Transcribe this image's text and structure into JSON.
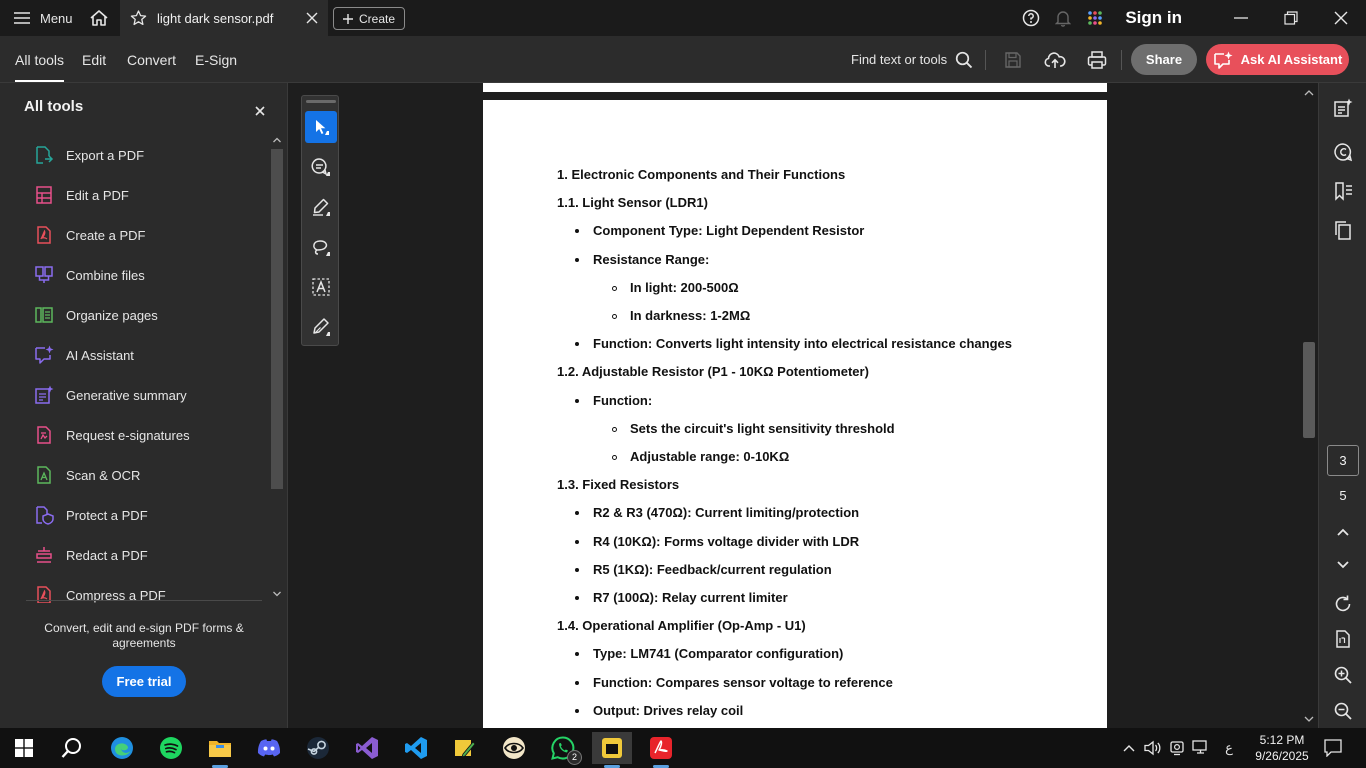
{
  "titlebar": {
    "menu_label": "Menu",
    "tab_title": "light dark sensor.pdf",
    "create_label": "Create",
    "sign_in": "Sign in"
  },
  "toolbar": {
    "tabs": [
      "All tools",
      "Edit",
      "Convert",
      "E-Sign"
    ],
    "find_label": "Find text or tools",
    "share_label": "Share",
    "ai_label": "Ask AI Assistant"
  },
  "left_panel": {
    "title": "All tools",
    "items": [
      {
        "label": "Export a PDF",
        "icon": "export-pdf-icon",
        "color": "#26a69a"
      },
      {
        "label": "Edit a PDF",
        "icon": "edit-pdf-icon",
        "color": "#e8508a"
      },
      {
        "label": "Create a PDF",
        "icon": "create-pdf-icon",
        "color": "#e8505b"
      },
      {
        "label": "Combine files",
        "icon": "combine-files-icon",
        "color": "#8a6cf0"
      },
      {
        "label": "Organize pages",
        "icon": "organize-pages-icon",
        "color": "#5cb85c"
      },
      {
        "label": "AI Assistant",
        "icon": "ai-assistant-icon",
        "color": "#8a6cf0"
      },
      {
        "label": "Generative summary",
        "icon": "generative-summary-icon",
        "color": "#8a6cf0"
      },
      {
        "label": "Request e-signatures",
        "icon": "request-esignatures-icon",
        "color": "#e8508a"
      },
      {
        "label": "Scan & OCR",
        "icon": "scan-ocr-icon",
        "color": "#5cb85c"
      },
      {
        "label": "Protect a PDF",
        "icon": "protect-pdf-icon",
        "color": "#8a6cf0"
      },
      {
        "label": "Redact a PDF",
        "icon": "redact-pdf-icon",
        "color": "#e8508a"
      },
      {
        "label": "Compress a PDF",
        "icon": "compress-pdf-icon",
        "color": "#e8505b"
      }
    ],
    "promo_text": "Convert, edit and e-sign PDF forms & agreements",
    "free_trial_label": "Free trial"
  },
  "document": {
    "lines": [
      {
        "text": "1. Electronic Components and Their Functions",
        "level": 0
      },
      {
        "text": "1.1. Light Sensor (LDR1)",
        "level": 0
      },
      {
        "text": "Component Type: Light Dependent Resistor",
        "level": 1
      },
      {
        "text": "Resistance Range:",
        "level": 1
      },
      {
        "text": "In light: 200-500Ω",
        "level": 2
      },
      {
        "text": "In darkness: 1-2MΩ",
        "level": 2
      },
      {
        "text": "Function: Converts light intensity into electrical resistance changes",
        "level": 1
      },
      {
        "text": "1.2. Adjustable Resistor (P1 - 10KΩ Potentiometer)",
        "level": 0
      },
      {
        "text": "Function:",
        "level": 1
      },
      {
        "text": "Sets the circuit's light sensitivity threshold",
        "level": 2
      },
      {
        "text": "Adjustable range: 0-10KΩ",
        "level": 2
      },
      {
        "text": "1.3. Fixed Resistors",
        "level": 0
      },
      {
        "text": "R2 & R3 (470Ω): Current limiting/protection",
        "level": 1
      },
      {
        "text": "R4 (10KΩ): Forms voltage divider with LDR",
        "level": 1
      },
      {
        "text": "R5 (1KΩ): Feedback/current regulation",
        "level": 1
      },
      {
        "text": "R7 (100Ω): Relay current limiter",
        "level": 1
      },
      {
        "text": "1.4. Operational Amplifier (Op-Amp - U1)",
        "level": 0
      },
      {
        "text": "Type: LM741 (Comparator configuration)",
        "level": 1
      },
      {
        "text": "Function: Compares sensor voltage to reference",
        "level": 1
      },
      {
        "text": "Output: Drives relay coil",
        "level": 1
      }
    ]
  },
  "right_rail": {
    "current_page": "3",
    "total_pages": "5"
  },
  "taskbar": {
    "time": "5:12 PM",
    "date": "9/26/2025",
    "whatsapp_badge": "2",
    "lang": "ع"
  },
  "colors": {
    "accent_blue": "#1473e6",
    "ai_red": "#e8505b",
    "share_gray": "#6e6e6e"
  }
}
